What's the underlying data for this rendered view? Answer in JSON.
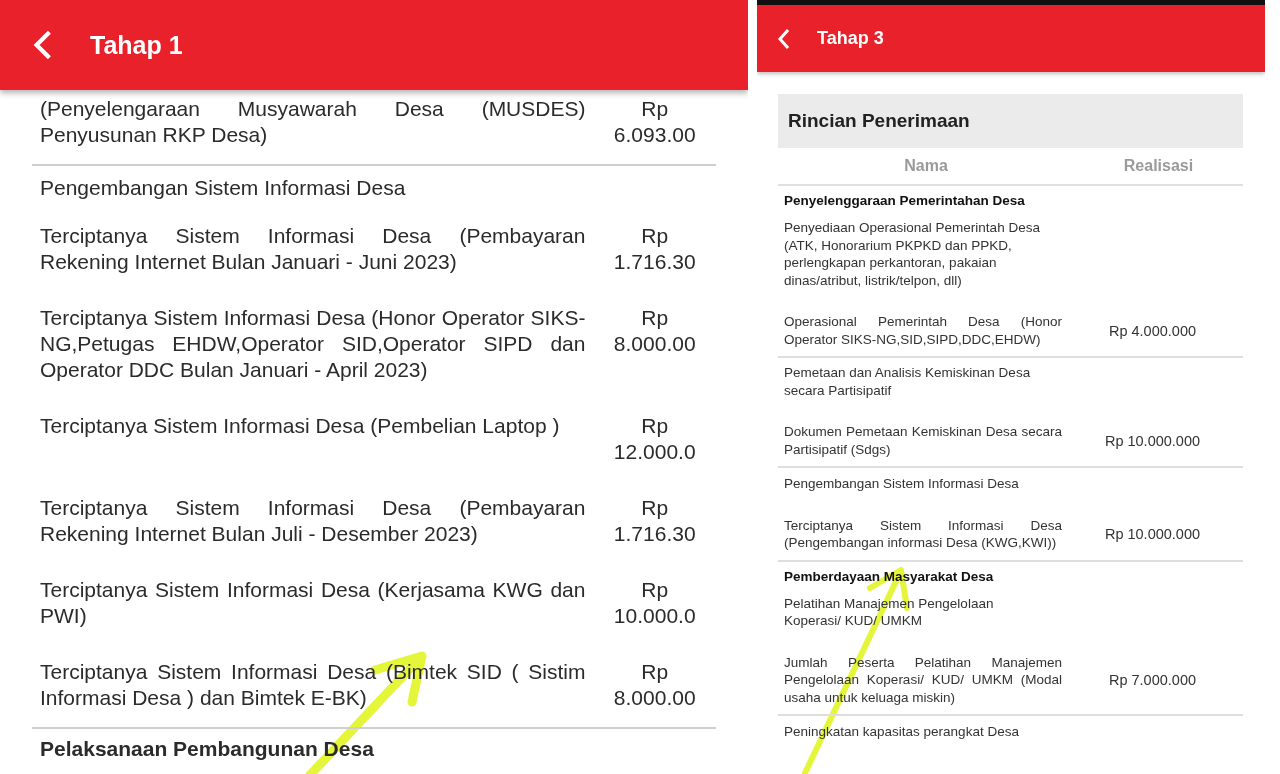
{
  "left_screen": {
    "title": "Tahap 1",
    "groups": [
      {
        "rows": [
          {
            "kind": "item",
            "name": "(Penyelengaraan Musyawarah Desa (MUSDES) Penyusunan RKP Desa)",
            "currency": "Rp",
            "amount": "6.093.00"
          }
        ]
      },
      {
        "rows": [
          {
            "kind": "subheading",
            "name": "Pengembangan Sistem Informasi Desa"
          },
          {
            "kind": "item",
            "name": "Terciptanya Sistem Informasi Desa (Pembayaran Rekening Internet Bulan Januari - Juni 2023)",
            "currency": "Rp",
            "amount": "1.716.30"
          },
          {
            "kind": "item",
            "name": "Terciptanya Sistem Informasi Desa (Honor Operator SIKS-NG,Petugas EHDW,Operator SID,Operator SIPD dan Operator DDC Bulan Januari - April 2023)",
            "currency": "Rp",
            "amount": "8.000.00"
          },
          {
            "kind": "item",
            "name": "Terciptanya Sistem Informasi Desa (Pembelian Laptop )",
            "currency": "Rp",
            "amount": "12.000.0"
          },
          {
            "kind": "item",
            "name": "Terciptanya Sistem Informasi Desa (Pembayaran Rekening Internet Bulan Juli - Desember 2023)",
            "currency": "Rp",
            "amount": "1.716.30"
          },
          {
            "kind": "item",
            "name": "Terciptanya Sistem Informasi Desa (Kerjasama KWG dan PWI)",
            "currency": "Rp",
            "amount": "10.000.0"
          },
          {
            "kind": "item",
            "name": "Terciptanya Sistem Informasi Desa (Bimtek SID ( Sistim Informasi Desa ) dan Bimtek E-BK)",
            "currency": "Rp",
            "amount": "8.000.00"
          }
        ]
      },
      {
        "rows": [
          {
            "kind": "heading",
            "name": "Pelaksanaan Pembangunan Desa"
          }
        ]
      }
    ]
  },
  "right_screen": {
    "title": "Tahap 3",
    "card_title": "Rincian Penerimaan",
    "columns": [
      "Nama",
      "Realisasi"
    ],
    "groups": [
      {
        "rows": [
          {
            "kind": "heading",
            "name": "Penyelenggaraan Pemerintahan Desa"
          },
          {
            "kind": "subheading",
            "name": "Penyediaan Operasional Pemerintah Desa (ATK, Honorarium PKPKD dan PPKD, perlengkapan perkantoran, pakaian dinas/atribut, listrik/telpon, dll)"
          },
          {
            "kind": "item",
            "name": "Operasional Pemerintah Desa (Honor Operator SIKS-NG,SID,SIPD,DDC,EHDW)",
            "amount": "Rp 4.000.000"
          }
        ]
      },
      {
        "rows": [
          {
            "kind": "subheading",
            "name": "Pemetaan dan Analisis Kemiskinan Desa secara Partisipatif"
          },
          {
            "kind": "item",
            "name": "Dokumen Pemetaan Kemiskinan Desa secara Partisipatif (Sdgs)",
            "amount": "Rp 10.000.000"
          }
        ]
      },
      {
        "rows": [
          {
            "kind": "subheading",
            "name": "Pengembangan Sistem Informasi Desa"
          },
          {
            "kind": "item",
            "name": "Terciptanya Sistem Informasi Desa (Pengembangan informasi Desa (KWG,KWI))",
            "amount": "Rp 10.000.000"
          }
        ]
      },
      {
        "rows": [
          {
            "kind": "heading",
            "name": "Pemberdayaan Masyarakat Desa"
          },
          {
            "kind": "subheading",
            "name": "Pelatihan Manajemen Pengelolaan Koperasi/ KUD/ UMKM"
          },
          {
            "kind": "item",
            "name": "Jumlah Peserta Pelatihan Manajemen Pengelolaan Koperasi/ KUD/ UMKM (Modal usaha untuk keluaga miskin)",
            "amount": "Rp 7.000.000"
          }
        ]
      },
      {
        "rows": [
          {
            "kind": "subheading",
            "name": "Peningkatan kapasitas perangkat Desa"
          }
        ]
      }
    ]
  }
}
